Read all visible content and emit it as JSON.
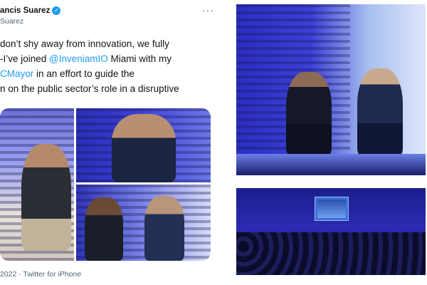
{
  "tweet": {
    "author_name": "ancis Suarez",
    "handle": "Suarez",
    "more_label": "···",
    "text_lines": [
      "don’t shy away from innovation, we fully",
      "-I’ve joined ",
      "@InveniamIO",
      " Miami with my",
      "CMayor",
      " in an effort to guide the",
      "n on the public sector’s role in a disruptive"
    ],
    "footer": "2022 · Twitter for iPhone"
  },
  "colors": {
    "link": "#1d9bf0",
    "text": "#0f1419",
    "secondary": "#536471",
    "stage_blue": "#3c40d6"
  },
  "icons": [
    "verified-badge-icon",
    "more-options-icon"
  ]
}
